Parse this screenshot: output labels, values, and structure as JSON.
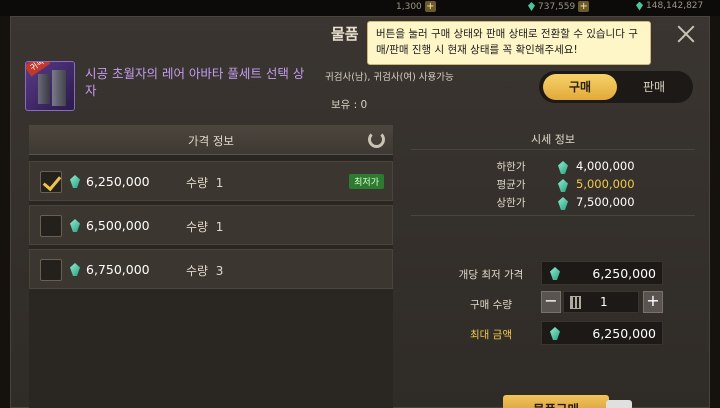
{
  "hud": {
    "items": [
      {
        "value": "1,300"
      },
      {
        "value": "737,559"
      },
      {
        "value": "148,142,827"
      }
    ]
  },
  "window": {
    "title": "물품",
    "tooltip": "버튼을 눌러 구매 상태와 판매 상태로 전환할 수 있습니다 구매/판매 진행 시 현재 상태를 꼭 확인해주세요!"
  },
  "item": {
    "icon_tag": "귀속",
    "name": "시공 초월자의 레어 아바타 풀세트 선택 상자",
    "classes": "귀검사(남), 귀검사(여) 사용가능",
    "owned": "보유 : 0"
  },
  "mode_toggle": {
    "buy_label": "구매",
    "sell_label": "판매"
  },
  "listings": {
    "header": "가격 정보",
    "qty_label": "수량",
    "lowest_badge": "최저가",
    "rows": [
      {
        "price": "6,250,000",
        "qty": "1",
        "checked": true,
        "lowest": true
      },
      {
        "price": "6,500,000",
        "qty": "1",
        "checked": false,
        "lowest": false
      },
      {
        "price": "6,750,000",
        "qty": "3",
        "checked": false,
        "lowest": false
      }
    ]
  },
  "market": {
    "title": "시세 정보",
    "low_label": "하한가",
    "low_value": "4,000,000",
    "avg_label": "평균가",
    "avg_value": "5,000,000",
    "high_label": "상한가",
    "high_value": "7,500,000"
  },
  "purchase": {
    "unit_price_label": "개당 최저 가격",
    "unit_price_value": "6,250,000",
    "qty_label": "구매 수량",
    "qty_value": "1",
    "max_label": "최대 금액",
    "max_value": "6,250,000",
    "buy_button": "물품구매"
  },
  "colors": {
    "accent_gold": "#f3c94a",
    "item_name": "#c59cf0",
    "gem": "#4fc3a0",
    "lowest_badge": "#2e7a30"
  }
}
